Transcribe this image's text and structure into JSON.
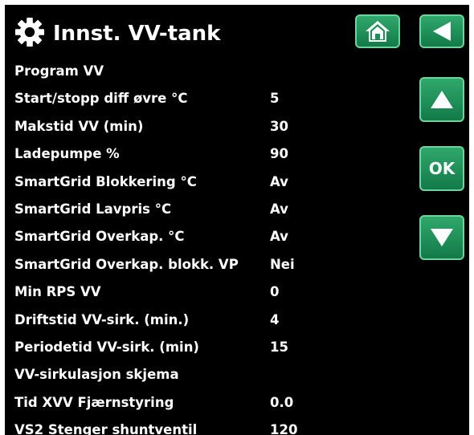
{
  "header": {
    "title": "Innst. VV-tank",
    "icons": {
      "settings": "gear-icon",
      "home": "home-icon",
      "back": "back-arrow-icon"
    }
  },
  "nav": {
    "up_icon": "arrow-up-icon",
    "ok_label": "OK",
    "down_icon": "arrow-down-icon"
  },
  "colors": {
    "background": "#000000",
    "button": "#1f8f58",
    "text": "#ffffff"
  },
  "menu": [
    {
      "label": "Program VV",
      "value": ""
    },
    {
      "label": "Start/stopp diff øvre °C",
      "value": "5"
    },
    {
      "label": "Makstid VV (min)",
      "value": "30"
    },
    {
      "label": "Ladepumpe %",
      "value": "90"
    },
    {
      "label": "SmartGrid Blokkering °C",
      "value": "Av"
    },
    {
      "label": "SmartGrid Lavpris °C",
      "value": "Av"
    },
    {
      "label": "SmartGrid Overkap. °C",
      "value": "Av"
    },
    {
      "label": "SmartGrid Overkap. blokk. VP",
      "value": "Nei"
    },
    {
      "label": "Min RPS VV",
      "value": "0"
    },
    {
      "label": "Driftstid VV-sirk. (min.)",
      "value": "4"
    },
    {
      "label": "Periodetid VV-sirk. (min)",
      "value": "15"
    },
    {
      "label": "VV-sirkulasjon skjema",
      "value": ""
    },
    {
      "label": "Tid XVV Fjærnstyring",
      "value": "0.0"
    },
    {
      "label": "VS2 Stenger shuntventil",
      "value": "120"
    }
  ]
}
